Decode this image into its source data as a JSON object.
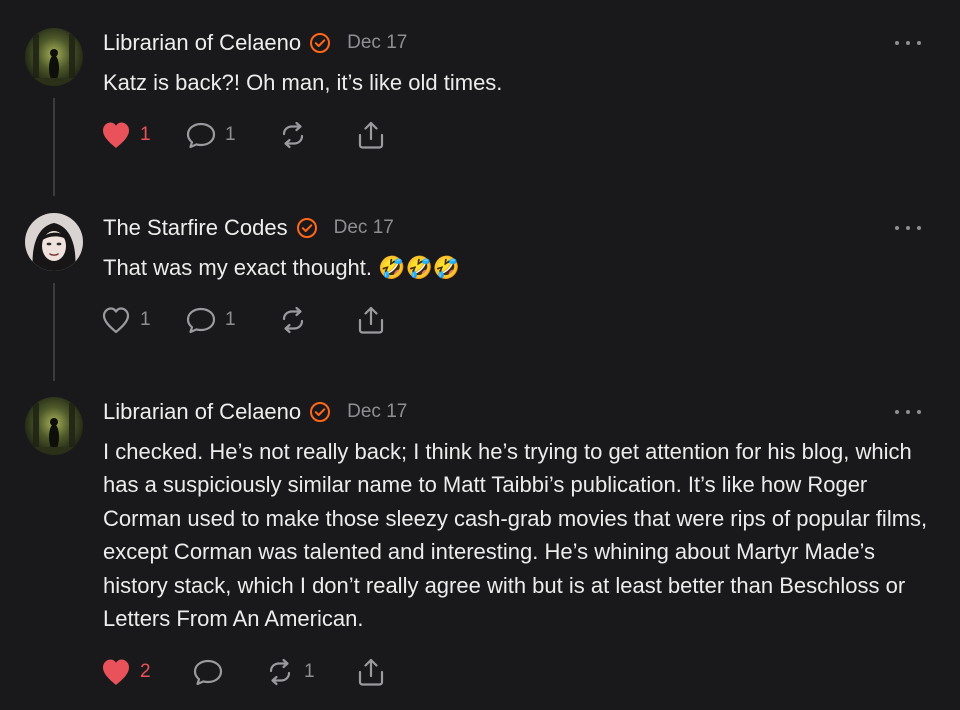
{
  "comments": [
    {
      "author": "Librarian of Celaeno",
      "date": "Dec 17",
      "text": "Katz is back?! Oh man, it’s like old times.",
      "liked": true,
      "likes": "1",
      "replies": "1",
      "restacks": ""
    },
    {
      "author": "The Starfire Codes",
      "date": "Dec 17",
      "text": "That was my exact thought. 🤣🤣🤣",
      "liked": false,
      "likes": "1",
      "replies": "1",
      "restacks": ""
    },
    {
      "author": "Librarian of Celaeno",
      "date": "Dec 17",
      "text": "I checked. He’s not really back; I think he’s trying to get attention for his blog, which has a suspiciously similar name to Matt Taibbi’s publication. It’s like how Roger Corman used to make those sleezy cash-grab movies that were rips of popular films, except Corman was talented and interesting. He’s whining about Martyr Made’s history stack, which I don’t really agree with but is at least better than Beschloss or Letters From An American.",
      "liked": true,
      "likes": "2",
      "replies": "",
      "restacks": "1"
    }
  ],
  "colors": {
    "background": "#19191b",
    "verified_badge": "#ff6719",
    "like_active": "#e9525b",
    "muted": "#8e8e93",
    "thread_line": "#3b3b3d"
  },
  "icons": {
    "verified": "verified-badge-icon",
    "like": "heart-icon",
    "reply": "speech-bubble-icon",
    "restack": "restack-arrows-icon",
    "share": "share-upload-icon",
    "more": "ellipsis-icon"
  }
}
